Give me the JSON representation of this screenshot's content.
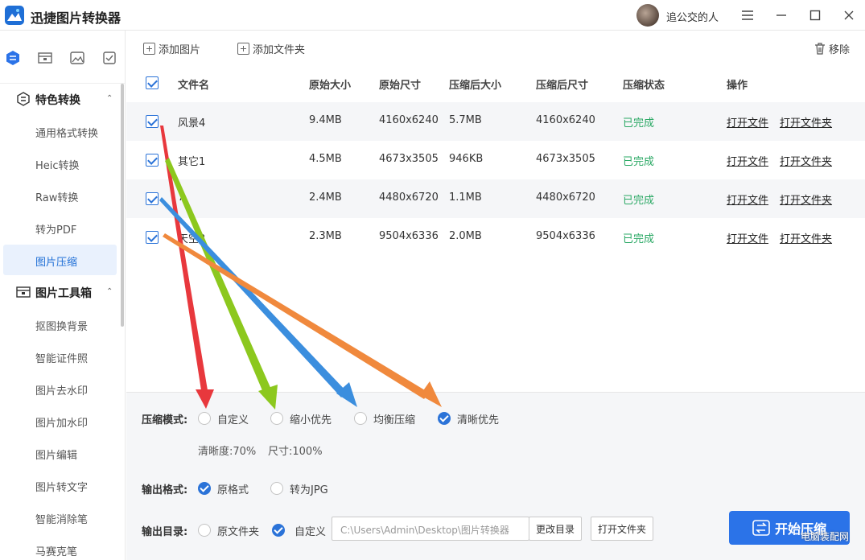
{
  "app": {
    "title": "迅捷图片转换器",
    "username": "追公交的人"
  },
  "sidebar": {
    "categories": [
      {
        "label": "特色转换",
        "items": [
          "通用格式转换",
          "Heic转换",
          "Raw转换",
          "转为PDF",
          "图片压缩"
        ]
      },
      {
        "label": "图片工具箱",
        "items": [
          "抠图换背景",
          "智能证件照",
          "图片去水印",
          "图片加水印",
          "图片编辑",
          "图片转文字",
          "智能消除笔",
          "马赛克笔"
        ]
      }
    ],
    "active_item": "图片压缩"
  },
  "toolbar": {
    "add_image": "添加图片",
    "add_folder": "添加文件夹",
    "remove": "移除"
  },
  "table": {
    "headers": [
      "文件名",
      "原始大小",
      "原始尺寸",
      "压缩后大小",
      "压缩后尺寸",
      "压缩状态",
      "操作"
    ],
    "rows": [
      {
        "name": "风景4",
        "size": "9.4MB",
        "dims": "4160x6240",
        "csize": "5.7MB",
        "cdims": "4160x6240",
        "status": "已完成",
        "open_file": "打开文件",
        "open_folder": "打开文件夹"
      },
      {
        "name": "其它1",
        "size": "4.5MB",
        "dims": "4673x3505",
        "csize": "946KB",
        "cdims": "4673x3505",
        "status": "已完成",
        "open_file": "打开文件",
        "open_folder": "打开文件夹"
      },
      {
        "name": "7",
        "size": "2.4MB",
        "dims": "4480x6720",
        "csize": "1.1MB",
        "cdims": "4480x6720",
        "status": "已完成",
        "open_file": "打开文件",
        "open_folder": "打开文件夹"
      },
      {
        "name": "天空3",
        "size": "2.3MB",
        "dims": "9504x6336",
        "csize": "2.0MB",
        "cdims": "9504x6336",
        "status": "已完成",
        "open_file": "打开文件",
        "open_folder": "打开文件夹"
      }
    ]
  },
  "settings": {
    "mode_label": "压缩模式:",
    "modes": [
      "自定义",
      "缩小优先",
      "均衡压缩",
      "清晰优先"
    ],
    "mode_selected": "清晰优先",
    "clarity": "清晰度:70%",
    "size": "尺寸:100%",
    "format_label": "输出格式:",
    "formats": [
      "原格式",
      "转为JPG"
    ],
    "format_selected": "原格式",
    "dir_label": "输出目录:",
    "dirs": [
      "原文件夹",
      "自定义"
    ],
    "dir_selected": "自定义",
    "path": "C:\\Users\\Admin\\Desktop\\图片转换器",
    "change_dir": "更改目录",
    "open_folder": "打开文件夹",
    "start": "开始压缩"
  },
  "watermark": "电脑装配网",
  "colors": {
    "accent": "#2b73e8",
    "status": "#2aa864",
    "arrow_red": "#e8383d",
    "arrow_green": "#8cc81e",
    "arrow_blue": "#3b8ede",
    "arrow_orange": "#f0893d"
  }
}
